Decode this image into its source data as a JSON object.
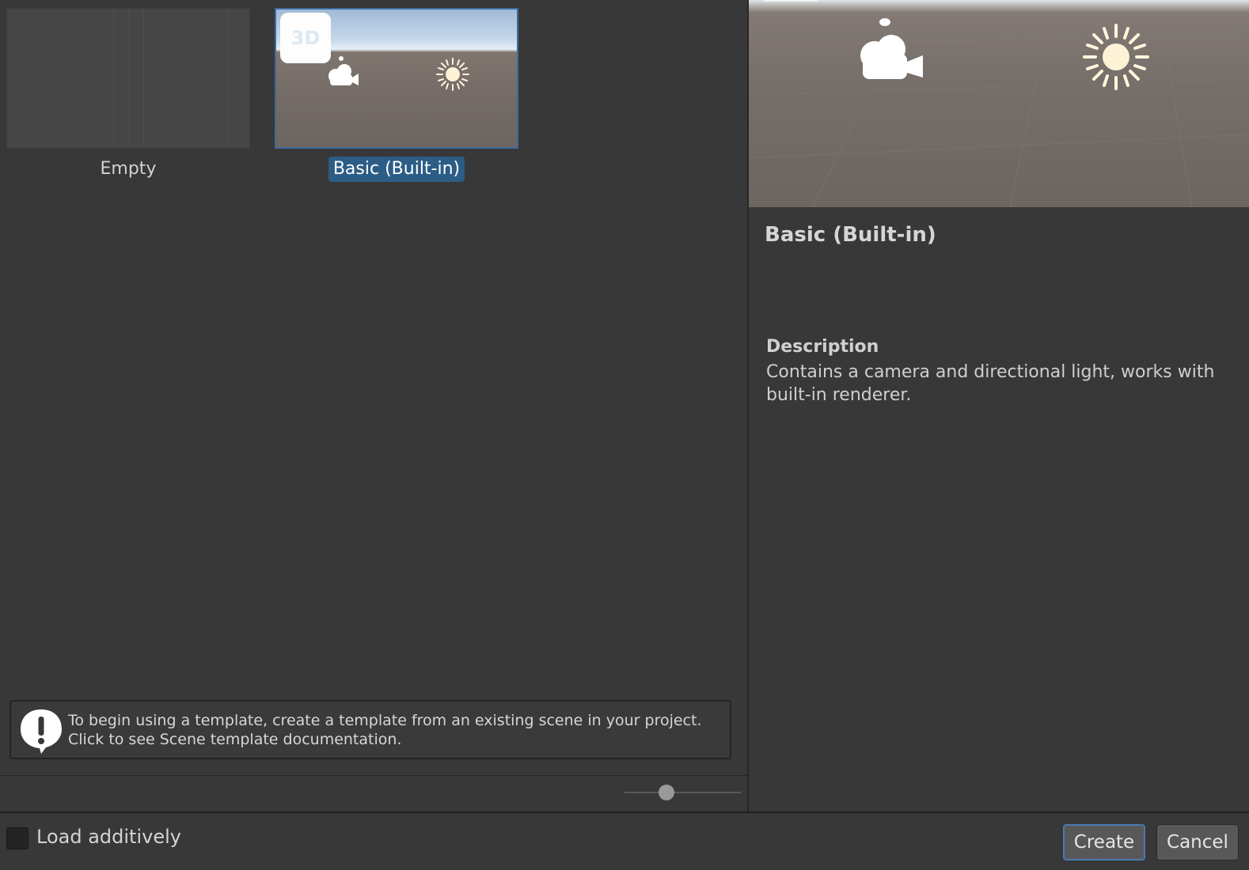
{
  "templates": [
    {
      "label": "Empty",
      "selected": false
    },
    {
      "label": "Basic (Built-in)",
      "selected": true,
      "badge": "3D"
    }
  ],
  "info": {
    "line1": "To begin using a template, create a template from an existing scene in your project.",
    "line2": "Click to see Scene template documentation."
  },
  "details": {
    "title": "Basic (Built-in)",
    "description_heading": "Description",
    "description": "Contains a camera and directional light, works with built-in renderer."
  },
  "footer": {
    "load_additively_label": "Load additively",
    "load_additively_checked": false,
    "create_label": "Create",
    "cancel_label": "Cancel"
  },
  "zoom_slider_value": 0.36,
  "colors": {
    "selection": "#2c5d87",
    "focus_border": "#4a7ab0",
    "panel_bg": "#383838"
  },
  "icons": [
    "camera-icon",
    "directional-light-icon",
    "warning-icon",
    "badge-3d-icon"
  ]
}
